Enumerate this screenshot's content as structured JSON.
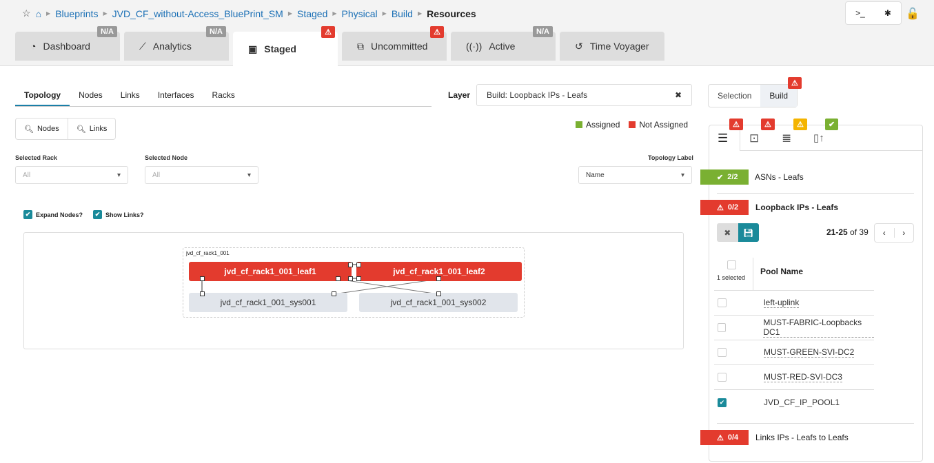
{
  "breadcrumb": [
    "Blueprints",
    "JVD_CF_without-Access_BluePrint_SM",
    "Staged",
    "Physical",
    "Build",
    "Resources"
  ],
  "tabs": [
    {
      "label": "Dashboard",
      "badge": "N/A"
    },
    {
      "label": "Analytics",
      "badge": "N/A"
    },
    {
      "label": "Staged",
      "badge": "!"
    },
    {
      "label": "Uncommitted",
      "badge": "!"
    },
    {
      "label": "Active",
      "badge": "N/A"
    },
    {
      "label": "Time Voyager"
    }
  ],
  "subtabs": [
    "Topology",
    "Nodes",
    "Links",
    "Interfaces",
    "Racks"
  ],
  "layer": {
    "label": "Layer",
    "value": "Build: Loopback IPs - Leafs"
  },
  "search": {
    "nodes": "Nodes",
    "links": "Links"
  },
  "legend": {
    "assigned": "Assigned",
    "not_assigned": "Not Assigned",
    "assigned_color": "#7ab032",
    "not_assigned_color": "#e33b2e"
  },
  "filters": {
    "rack_label": "Selected Rack",
    "rack_value": "All",
    "node_label": "Selected Node",
    "node_value": "All",
    "topo_label": "Topology Label",
    "topo_value": "Name"
  },
  "options": {
    "expand": "Expand Nodes?",
    "show_links": "Show Links?"
  },
  "topology": {
    "rack": "jvd_cf_rack1_001",
    "leaf1": "jvd_cf_rack1_001_leaf1",
    "leaf2": "jvd_cf_rack1_001_leaf2",
    "sys1": "jvd_cf_rack1_001_sys001",
    "sys2": "jvd_cf_rack1_001_sys002"
  },
  "panel": {
    "selection": "Selection",
    "build": "Build",
    "groups": [
      {
        "count": "2/2",
        "label": "ASNs - Leafs"
      },
      {
        "count": "0/2",
        "label": "Loopback IPs - Leafs"
      },
      {
        "count": "0/4",
        "label": "Links IPs - Leafs to Leafs"
      }
    ],
    "pagination": "21-25",
    "of": "of 39",
    "selected": "1 selected",
    "col": "Pool Name",
    "pools": [
      {
        "name": "left-uplink",
        "checked": false
      },
      {
        "name": "MUST-FABRIC-Loopbacks DC1",
        "checked": false
      },
      {
        "name": "MUST-GREEN-SVI-DC2",
        "checked": false
      },
      {
        "name": "MUST-RED-SVI-DC3",
        "checked": false
      },
      {
        "name": "JVD_CF_IP_POOL1",
        "checked": true
      }
    ]
  }
}
